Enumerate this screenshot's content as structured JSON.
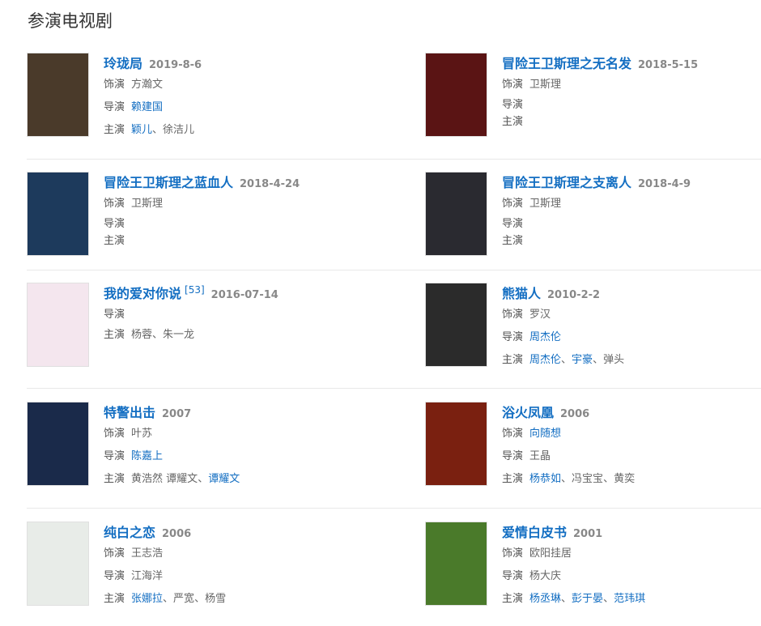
{
  "section_title": "参演电视剧",
  "cards": [
    {
      "title": "玲珑局",
      "date": "2019-8-6",
      "sup": "",
      "poster": {
        "bg": "#4a3a2a",
        "text": ""
      },
      "lines": [
        {
          "label": "饰演",
          "items": [
            {
              "text": "方瀚文",
              "link": false
            }
          ]
        },
        {
          "label": "导演",
          "items": [
            {
              "text": "赖建国",
              "link": true
            }
          ]
        },
        {
          "label": "主演",
          "items": [
            {
              "text": "颖儿",
              "link": true
            },
            {
              "text": "、",
              "link": false
            },
            {
              "text": "徐洁儿",
              "link": false
            }
          ]
        }
      ]
    },
    {
      "title": "冒险王卫斯理之无名发",
      "date": "2018-5-15",
      "sup": "",
      "poster": {
        "bg": "#5a1414",
        "text": ""
      },
      "lines": [
        {
          "label": "饰演",
          "items": [
            {
              "text": "卫斯理",
              "link": false
            }
          ]
        },
        {
          "label": "导演",
          "items": []
        },
        {
          "label": "主演",
          "items": []
        }
      ]
    },
    {
      "title": "冒险王卫斯理之蓝血人",
      "date": "2018-4-24",
      "sup": "",
      "poster": {
        "bg": "#1d3a5c",
        "text": ""
      },
      "lines": [
        {
          "label": "饰演",
          "items": [
            {
              "text": "卫斯理",
              "link": false
            }
          ]
        },
        {
          "label": "导演",
          "items": []
        },
        {
          "label": "主演",
          "items": []
        }
      ]
    },
    {
      "title": "冒险王卫斯理之支离人",
      "date": "2018-4-9",
      "sup": "",
      "poster": {
        "bg": "#2a2a30",
        "text": ""
      },
      "lines": [
        {
          "label": "饰演",
          "items": [
            {
              "text": "卫斯理",
              "link": false
            }
          ]
        },
        {
          "label": "导演",
          "items": []
        },
        {
          "label": "主演",
          "items": []
        }
      ]
    },
    {
      "title": "我的爱对你说",
      "date": "2016-07-14",
      "sup": "[53]",
      "poster": {
        "bg": "#f4e6ee",
        "text": ""
      },
      "lines": [
        {
          "label": "导演",
          "items": []
        },
        {
          "label": "主演",
          "items": [
            {
              "text": "杨蓉",
              "link": false
            },
            {
              "text": "、",
              "link": false
            },
            {
              "text": "朱一龙",
              "link": false
            }
          ]
        }
      ]
    },
    {
      "title": "熊猫人",
      "date": "2010-2-2",
      "sup": "",
      "poster": {
        "bg": "#2b2b2b",
        "text": ""
      },
      "lines": [
        {
          "label": "饰演",
          "items": [
            {
              "text": "罗汉",
              "link": false
            }
          ]
        },
        {
          "label": "导演",
          "items": [
            {
              "text": "周杰伦",
              "link": true
            }
          ]
        },
        {
          "label": "主演",
          "items": [
            {
              "text": "周杰伦",
              "link": true
            },
            {
              "text": "、",
              "link": false
            },
            {
              "text": "宇豪",
              "link": true
            },
            {
              "text": "、",
              "link": false
            },
            {
              "text": "弹头",
              "link": false
            }
          ]
        }
      ]
    },
    {
      "title": "特警出击",
      "date": "2007",
      "sup": "",
      "poster": {
        "bg": "#1a2a4a",
        "text": ""
      },
      "lines": [
        {
          "label": "饰演",
          "items": [
            {
              "text": "叶苏",
              "link": false
            }
          ]
        },
        {
          "label": "导演",
          "items": [
            {
              "text": "陈嘉上",
              "link": true
            }
          ]
        },
        {
          "label": "主演",
          "items": [
            {
              "text": "黄浩然",
              "link": false
            },
            {
              "text": " ",
              "link": false
            },
            {
              "text": "谭耀文",
              "link": false
            },
            {
              "text": "、",
              "link": false
            },
            {
              "text": "谭耀文",
              "link": true
            }
          ]
        }
      ]
    },
    {
      "title": "浴火凤凰",
      "date": "2006",
      "sup": "",
      "poster": {
        "bg": "#7a2010",
        "text": ""
      },
      "lines": [
        {
          "label": "饰演",
          "items": [
            {
              "text": "向随想",
              "link": true
            }
          ]
        },
        {
          "label": "导演",
          "items": [
            {
              "text": "王晶",
              "link": false
            }
          ]
        },
        {
          "label": "主演",
          "items": [
            {
              "text": "杨恭如",
              "link": true
            },
            {
              "text": "、",
              "link": false
            },
            {
              "text": "冯宝宝",
              "link": false
            },
            {
              "text": "、",
              "link": false
            },
            {
              "text": "黄奕",
              "link": false
            }
          ]
        }
      ]
    },
    {
      "title": "纯白之恋",
      "date": "2006",
      "sup": "",
      "poster": {
        "bg": "#e8ece8",
        "text": ""
      },
      "lines": [
        {
          "label": "饰演",
          "items": [
            {
              "text": "王志浩",
              "link": false
            }
          ]
        },
        {
          "label": "导演",
          "items": [
            {
              "text": "江海洋",
              "link": false
            }
          ]
        },
        {
          "label": "主演",
          "items": [
            {
              "text": "张娜拉",
              "link": true
            },
            {
              "text": "、",
              "link": false
            },
            {
              "text": "严宽",
              "link": false
            },
            {
              "text": "、",
              "link": false
            },
            {
              "text": "杨雪",
              "link": false
            }
          ]
        }
      ]
    },
    {
      "title": "爱情白皮书",
      "date": "2001",
      "sup": "",
      "poster": {
        "bg": "#4a7a2a",
        "text": ""
      },
      "lines": [
        {
          "label": "饰演",
          "items": [
            {
              "text": "欧阳挂居",
              "link": false
            }
          ]
        },
        {
          "label": "导演",
          "items": [
            {
              "text": "杨大庆",
              "link": false
            }
          ]
        },
        {
          "label": "主演",
          "items": [
            {
              "text": "杨丞琳",
              "link": true
            },
            {
              "text": "、",
              "link": false
            },
            {
              "text": "彭于晏",
              "link": true
            },
            {
              "text": "、",
              "link": false
            },
            {
              "text": "范玮琪",
              "link": true
            }
          ]
        }
      ]
    }
  ]
}
